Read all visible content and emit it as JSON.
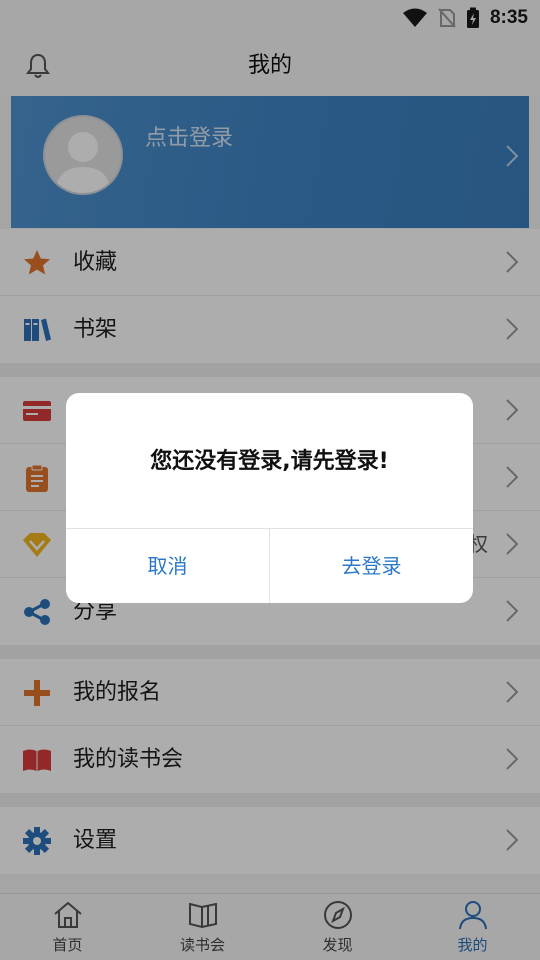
{
  "status": {
    "time": "8:35"
  },
  "header": {
    "title": "我的"
  },
  "profile": {
    "login_prompt": "点击登录"
  },
  "menu": {
    "groups": [
      [
        {
          "label": "收藏",
          "icon": "star-icon",
          "color": "#e0752b"
        },
        {
          "label": "书架",
          "icon": "bookshelf-icon",
          "color": "#2b70b8"
        }
      ],
      [
        {
          "label": "",
          "icon": "card-icon",
          "color": "#d93c3c"
        },
        {
          "label": "",
          "icon": "clipboard-icon",
          "color": "#e0752b"
        },
        {
          "label": "",
          "icon": "gem-icon",
          "color": "#f2b51e",
          "trailing": "权"
        },
        {
          "label": "分享",
          "icon": "share-icon",
          "color": "#2b70b8"
        }
      ],
      [
        {
          "label": "我的报名",
          "icon": "plus-icon",
          "color": "#e0752b"
        },
        {
          "label": "我的读书会",
          "icon": "book-icon",
          "color": "#d93c3c"
        }
      ],
      [
        {
          "label": "设置",
          "icon": "gear-icon",
          "color": "#2b70b8"
        }
      ]
    ]
  },
  "tabbar": {
    "tabs": [
      {
        "label": "首页",
        "icon": "home-icon"
      },
      {
        "label": "读书会",
        "icon": "book-open-icon"
      },
      {
        "label": "发现",
        "icon": "compass-icon"
      },
      {
        "label": "我的",
        "icon": "person-icon",
        "active": true
      }
    ]
  },
  "dialog": {
    "message": "您还没有登录,请先登录!",
    "cancel_label": "取消",
    "confirm_label": "去登录"
  },
  "colors": {
    "accent": "#2b70b8",
    "profile_bg": "#3d84c4",
    "dialog_button": "#2b78c8"
  }
}
